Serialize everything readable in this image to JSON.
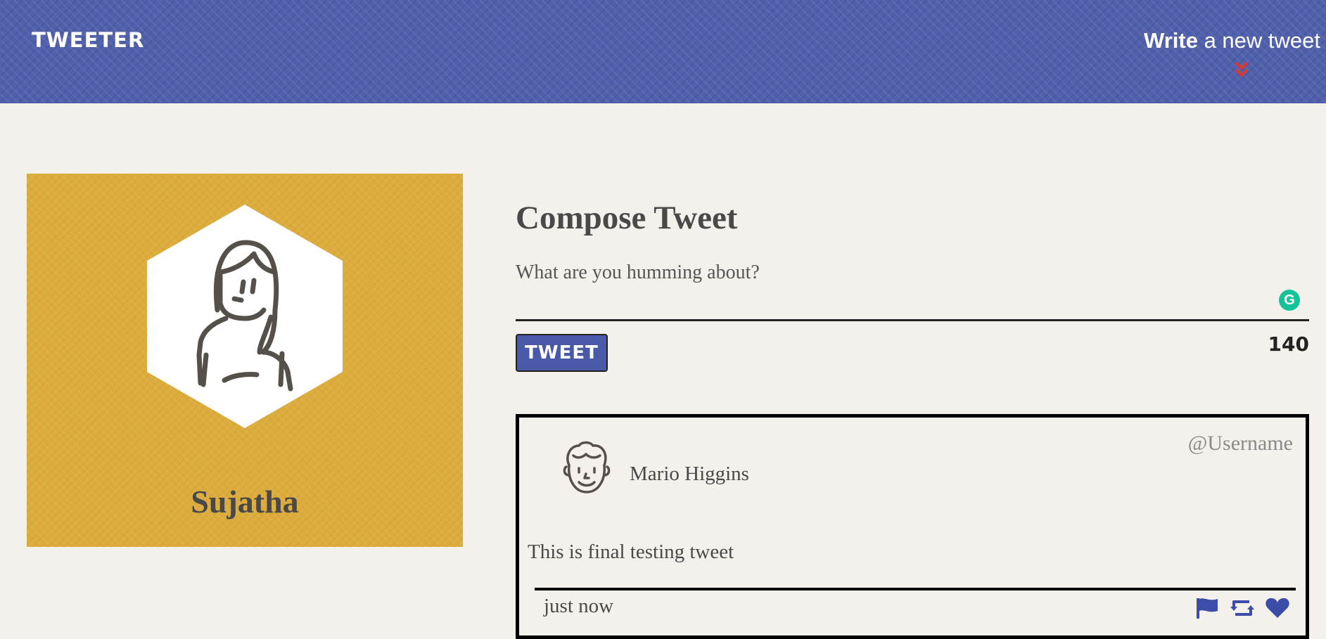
{
  "nav": {
    "brand": "TWEETER",
    "compose_bold": "Write",
    "compose_rest": " a new tweet",
    "accent_color": "#d8382e",
    "icon": "double-chevron-down-icon"
  },
  "profile": {
    "name": "Sujatha",
    "avatar_icon": "woman-avatar-icon",
    "background_color": "#dcac3c"
  },
  "compose": {
    "title": "Compose Tweet",
    "placeholder": "What are you humming about?",
    "value": "",
    "button_label": "TWEET",
    "counter": "140",
    "grammarly_label": "G"
  },
  "tweets": [
    {
      "avatar_icon": "man-avatar-icon",
      "name": "Mario Higgins",
      "handle": "@Username",
      "content": "This is final testing tweet",
      "time": "just now",
      "actions": [
        "flag-icon",
        "retweet-icon",
        "heart-icon"
      ]
    }
  ],
  "colors": {
    "nav_bg": "#5060ab",
    "button_bg": "#4a58a8",
    "action_icon": "#3b4da8",
    "page_bg": "#f4f1ec"
  }
}
